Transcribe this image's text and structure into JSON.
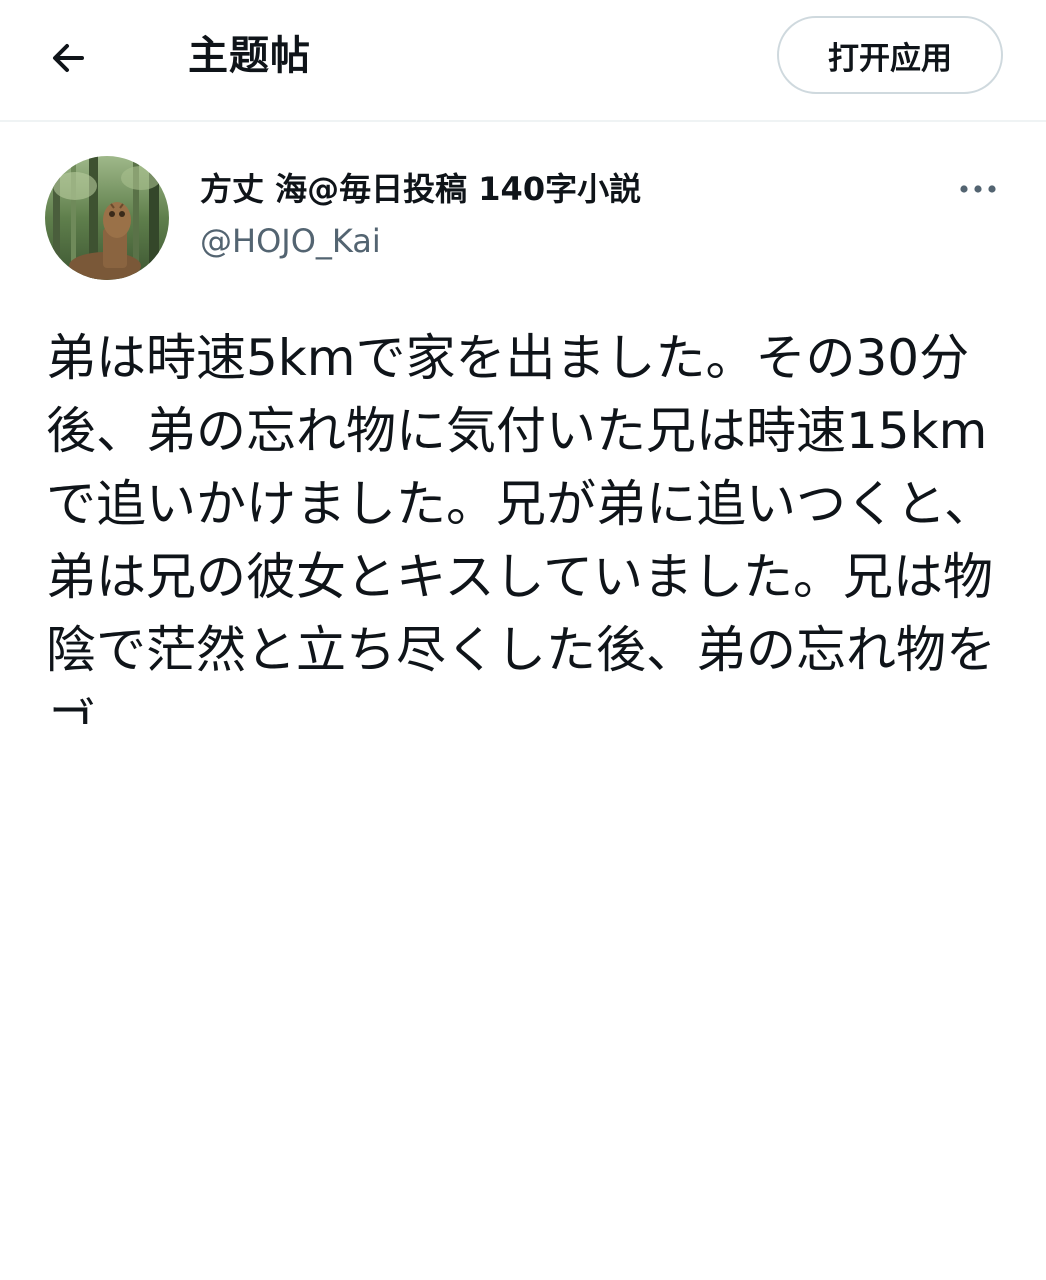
{
  "header": {
    "title": "主题帖",
    "open_app_label": "打开应用",
    "back_icon": "arrow-left-icon"
  },
  "tweet": {
    "author": {
      "display_name": "方丈 海@毎日投稿 140字小説",
      "handle": "@HOJO_Kai",
      "avatar": "owl-carving-in-forest-photo"
    },
    "more_icon": "more-horizontal-icon",
    "text": "弟は時速5kmで家を出ました。その30分後、弟の忘れ物に気付いた兄は時速15kmで追いかけました。兄が弟に追いつくと、弟は兄の彼女とキスしていました。兄は物陰で茫然と立ち尽くした後、弟の忘れ物をゴ"
  },
  "colors": {
    "text_primary": "#0f1419",
    "text_secondary": "#536471",
    "border": "#cfd9de",
    "divider": "#eff3f4"
  }
}
